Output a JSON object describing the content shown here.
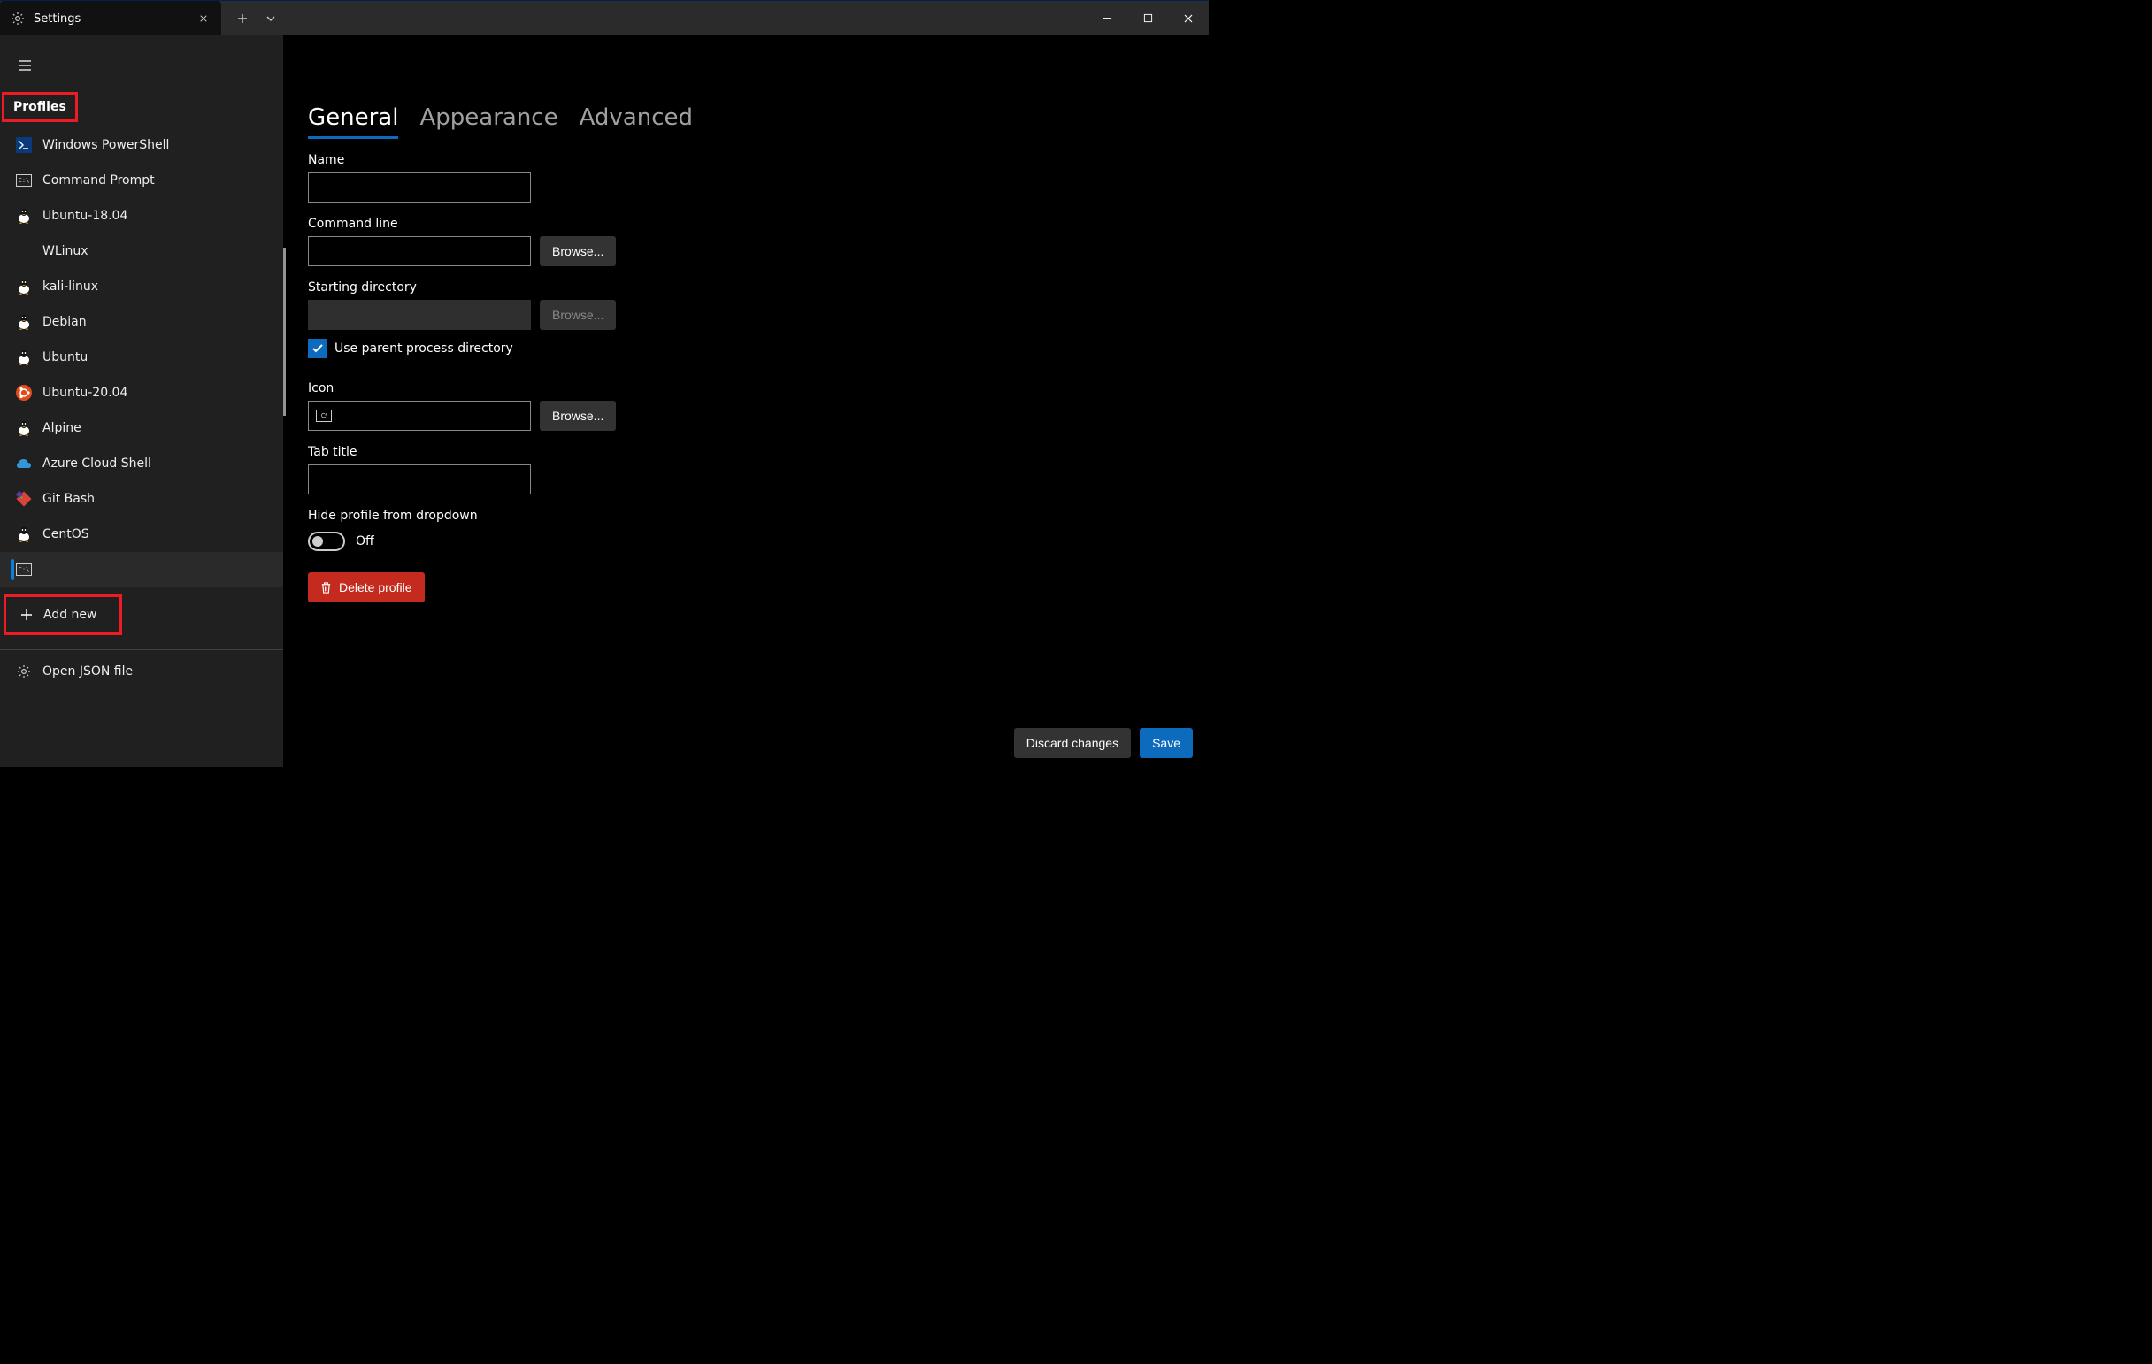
{
  "titlebar": {
    "tab_label": "Settings"
  },
  "sidebar": {
    "header": "Profiles",
    "items": [
      {
        "label": "Windows PowerShell",
        "icon": "powershell"
      },
      {
        "label": "Command Prompt",
        "icon": "cmd"
      },
      {
        "label": "Ubuntu-18.04",
        "icon": "tux"
      },
      {
        "label": "WLinux",
        "icon": "none"
      },
      {
        "label": "kali-linux",
        "icon": "tux"
      },
      {
        "label": "Debian",
        "icon": "tux"
      },
      {
        "label": "Ubuntu",
        "icon": "tux"
      },
      {
        "label": "Ubuntu-20.04",
        "icon": "ubuntu"
      },
      {
        "label": "Alpine",
        "icon": "tux"
      },
      {
        "label": "Azure Cloud Shell",
        "icon": "azure"
      },
      {
        "label": "Git Bash",
        "icon": "git"
      },
      {
        "label": "CentOS",
        "icon": "tux"
      }
    ],
    "add_new_label": "Add new",
    "open_json_label": "Open JSON file"
  },
  "main": {
    "tabs": {
      "general": "General",
      "appearance": "Appearance",
      "advanced": "Advanced"
    },
    "fields": {
      "name_label": "Name",
      "name_value": "",
      "cmdline_label": "Command line",
      "cmdline_value": "",
      "browse_label": "Browse...",
      "startdir_label": "Starting directory",
      "startdir_value": "",
      "use_parent_label": "Use parent process directory",
      "use_parent_checked": true,
      "icon_label": "Icon",
      "icon_value": "",
      "tabtitle_label": "Tab title",
      "tabtitle_value": "",
      "hide_label": "Hide profile from dropdown",
      "hide_state": "Off",
      "delete_label": "Delete profile"
    }
  },
  "footer": {
    "discard": "Discard changes",
    "save": "Save"
  }
}
